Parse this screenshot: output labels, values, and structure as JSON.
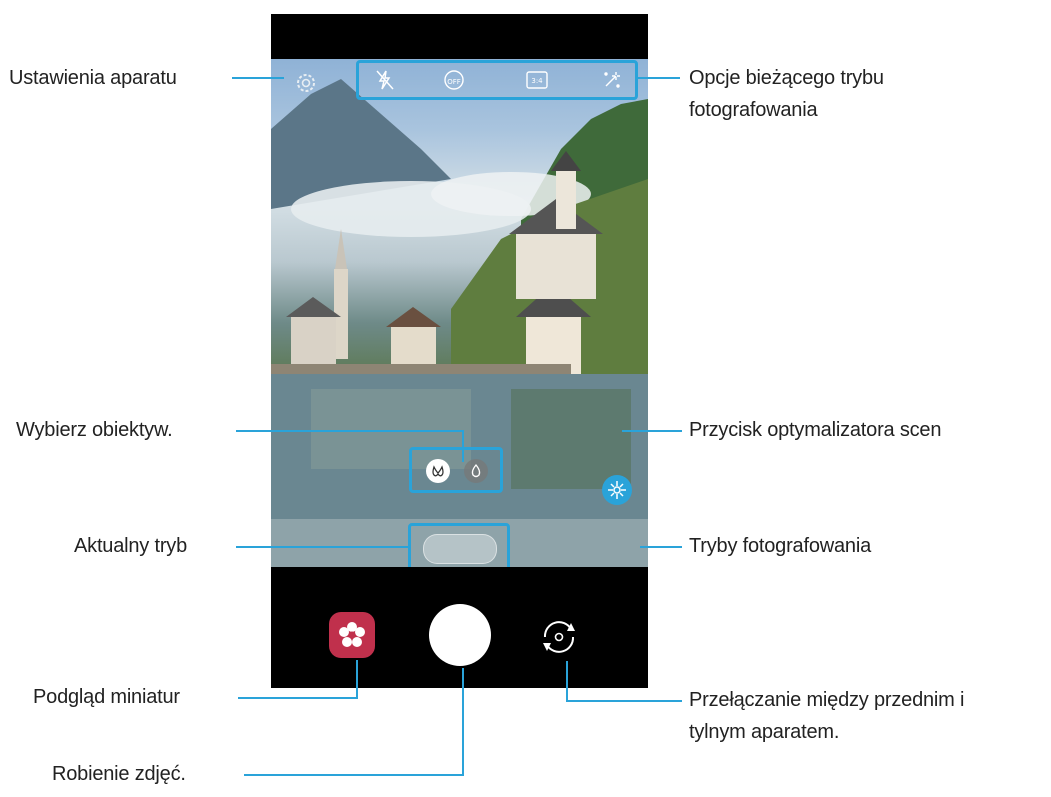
{
  "labels": {
    "camera_settings": "Ustawienia aparatu",
    "mode_options_line1": "Opcje bieżącego trybu",
    "mode_options_line2": "fotografowania",
    "select_lens": "Wybierz obiektyw.",
    "scene_optimizer": "Przycisk optymalizatora scen",
    "current_mode": "Aktualny tryb",
    "shooting_modes": "Tryby fotografowania",
    "thumbnail_preview": "Podgląd miniatur",
    "switch_line1": "Przełączanie między przednim i",
    "switch_line2": "tylnym aparatem.",
    "take_pictures": "Robienie zdjęć."
  },
  "toolbar": {
    "icons": [
      "flash-off-icon",
      "timer-off-icon",
      "aspect-ratio-icon",
      "filter-effects-icon"
    ],
    "timer_text": "OFF",
    "ratio_text": "3:4"
  },
  "colors": {
    "accent": "#2aa3d9",
    "gallery": "#c0304c",
    "phone_bg": "#000000"
  }
}
